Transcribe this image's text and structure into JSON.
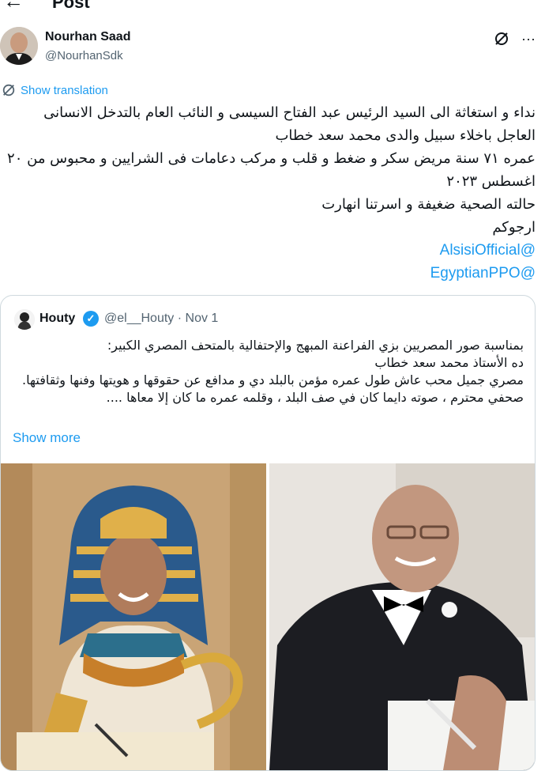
{
  "header": {
    "title": "Post",
    "back_icon": "arrow-left-icon"
  },
  "author": {
    "name": "Nourhan Saad",
    "handle": "@NourhanSdk"
  },
  "actions": {
    "grok_icon": "grok-icon",
    "more_icon": "more-dots-icon"
  },
  "translation": {
    "label": "Show translation",
    "icon": "translate-icon"
  },
  "tweet": {
    "lines": [
      "نداء و استغاثة الى السيد الرئيس عبد الفتاح السيسى و النائب العام بالتدخل الانسانى العاجل باخلاء سبيل والدى محمد سعد خطاب",
      "عمره ٧١ سنة مريض سكر و ضغط و قلب و مركب دعامات فى الشرايين و محبوس من ٢٠ اغسطس ٢٠٢٣",
      "حالته الصحية ضغيفة و اسرتنا انهارت",
      "ارجوكم"
    ],
    "mentions": [
      "@AlsisiOfficial",
      "@EgyptianPPO"
    ]
  },
  "quote": {
    "name": "Houty",
    "meta": "@el__Houty · Nov 1",
    "lines": [
      "بمناسبة صور المصريين بزي الفراعنة المبهج والإحتفالية بالمتحف المصري الكبير:",
      "ده الأستاذ محمد سعد خطاب",
      "مصري جميل محب عاش طول عمره مؤمن بالبلد دي و مدافع عن حقوقها و هويتها وفنها وثقافتها.",
      "صحفي محترم ، صوته دايما كان في صف البلد ، وقلمه عمره ما كان إلا معاها ...."
    ],
    "show_more": "Show more"
  },
  "colors": {
    "accent": "#1d9bf0",
    "text": "#0f1419",
    "muted": "#536471",
    "border": "#cfd9de"
  }
}
